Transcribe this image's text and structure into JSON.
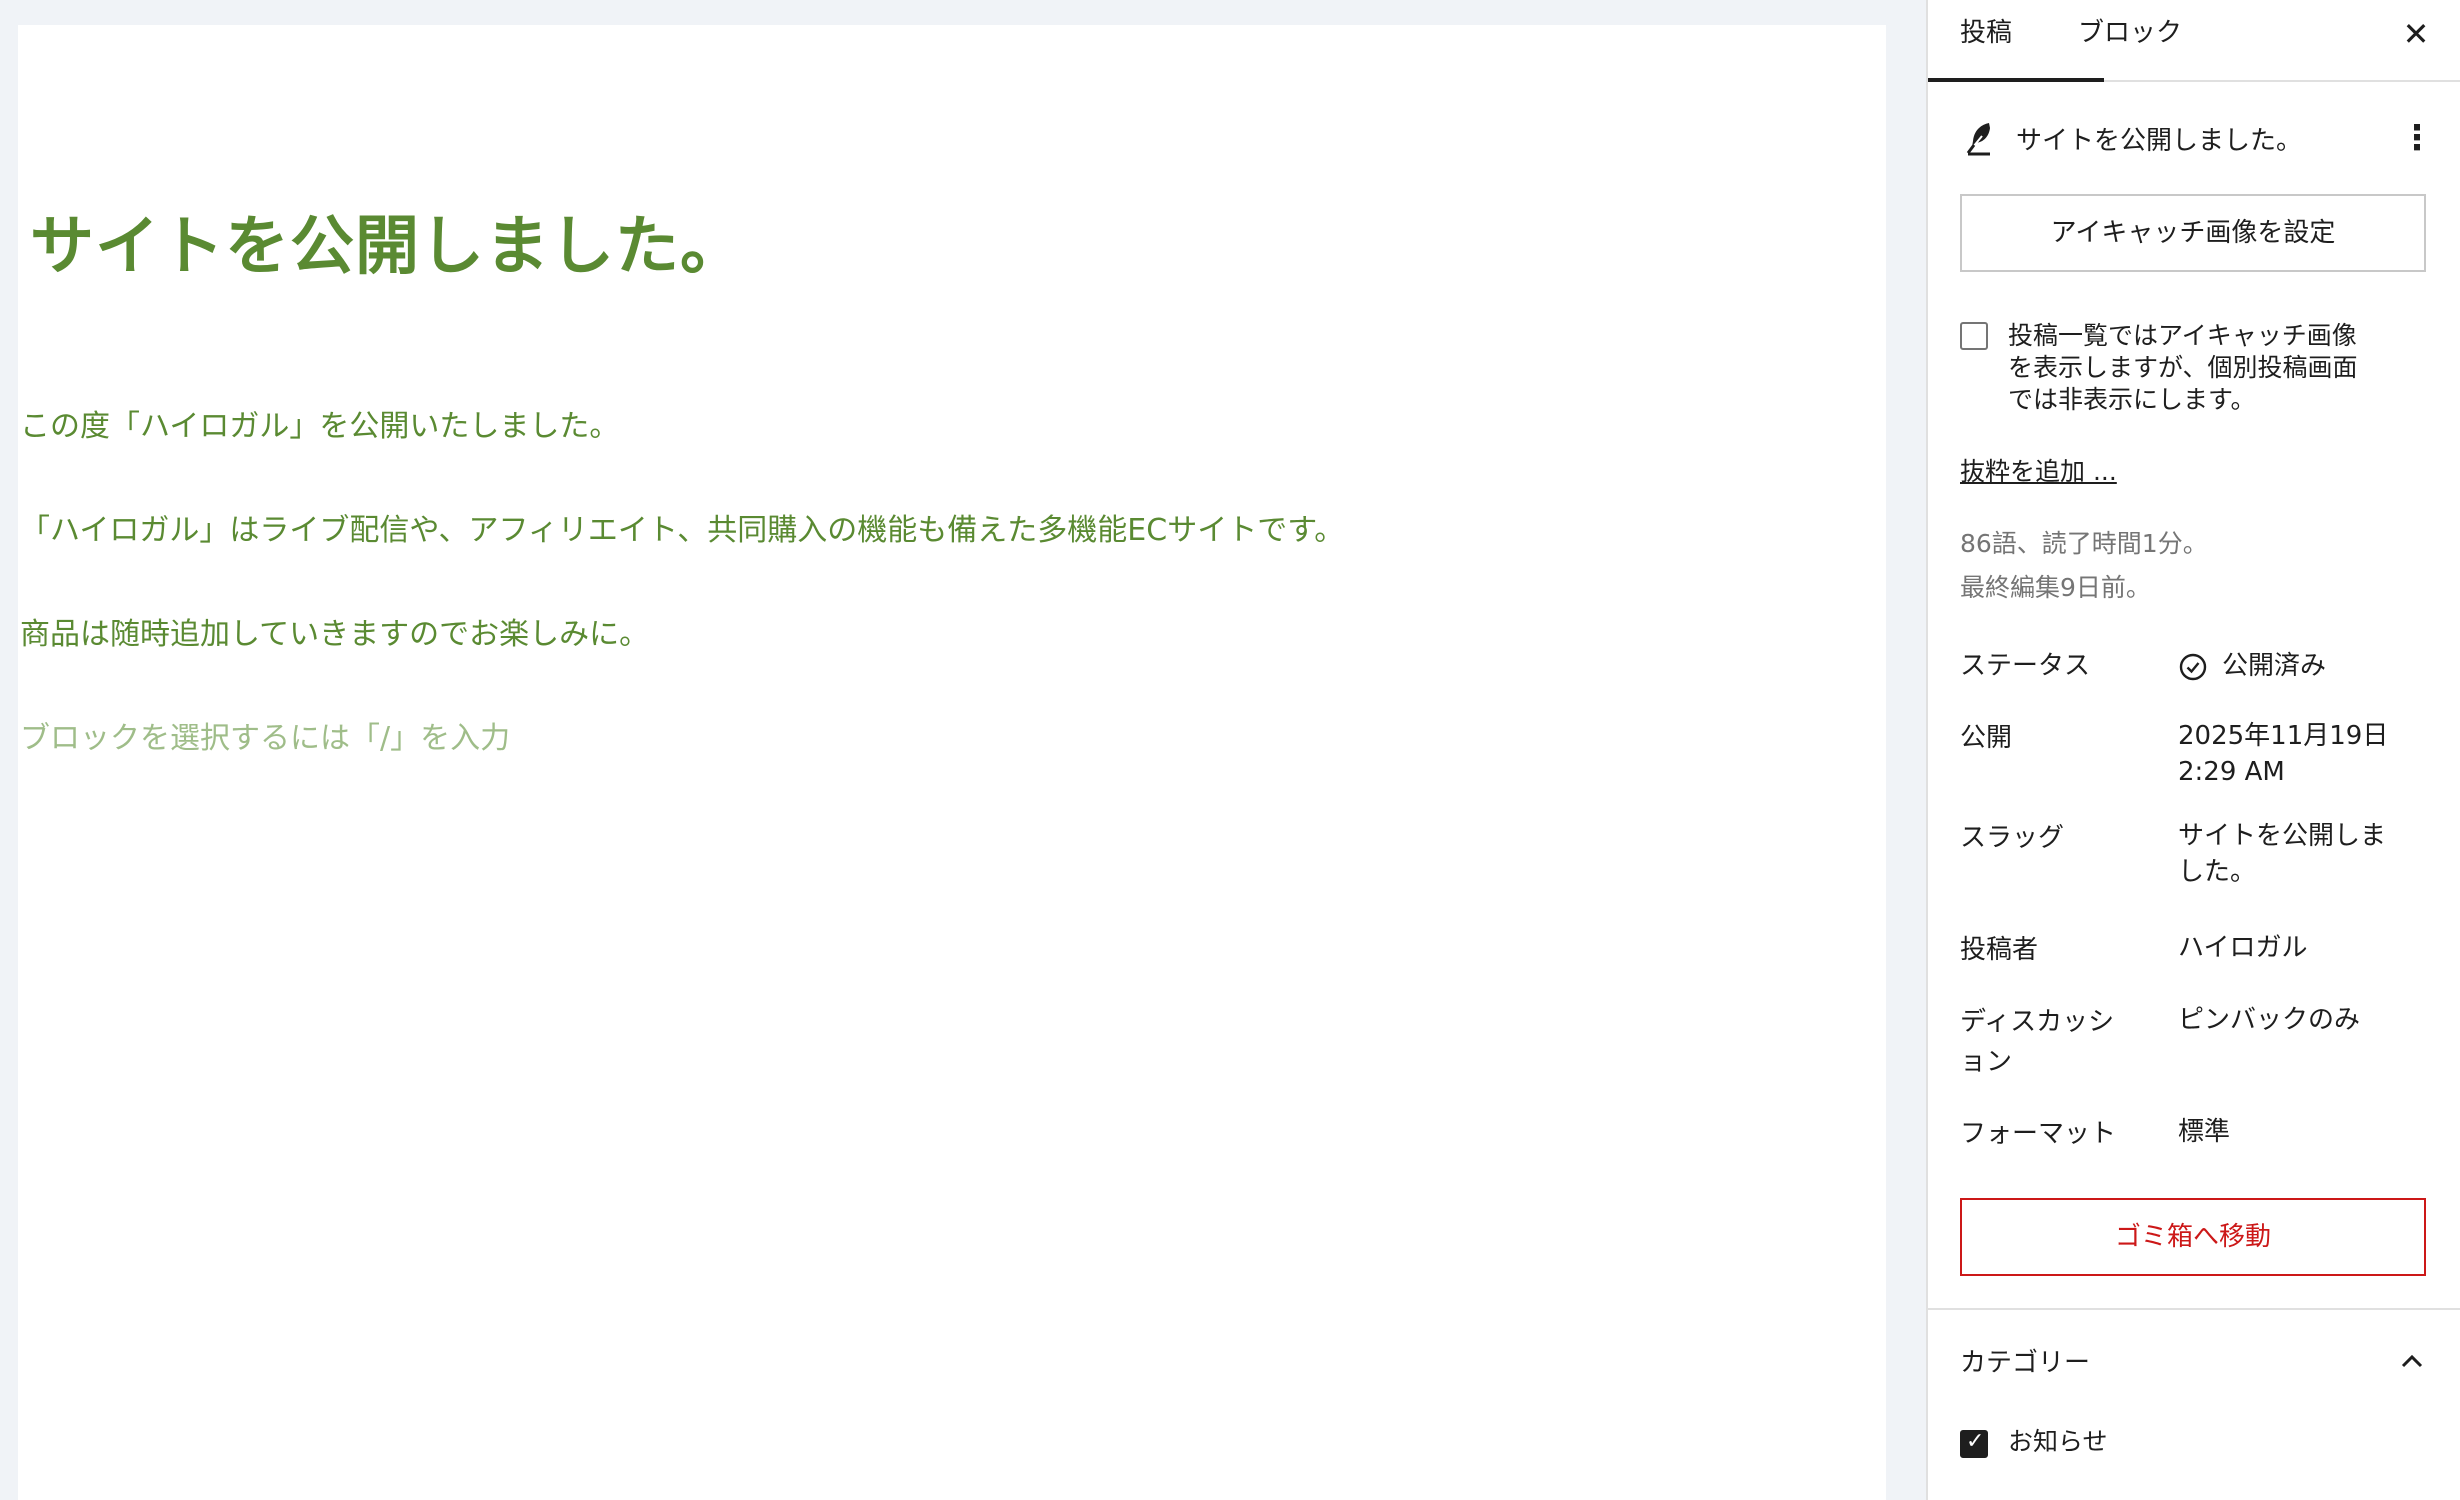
{
  "editor": {
    "title": "サイトを公開しました。",
    "paragraphs": [
      "この度「ハイロガル」を公開いたしました。",
      "「ハイロガル」はライブ配信や、アフィリエイト、共同購入の機能も備えた多機能ECサイトです。",
      "商品は随時追加していきますのでお楽しみに。"
    ],
    "placeholder": "ブロックを選択するには「/」を入力",
    "colors": {
      "text": "#5a8a32",
      "placeholder": "#9fbd89"
    }
  },
  "sidebar": {
    "tabs": [
      {
        "label": "投稿",
        "active": true
      },
      {
        "label": "ブロック",
        "active": false
      }
    ],
    "close_icon": "close-icon",
    "summary": {
      "icon": "feather-icon",
      "title": "サイトを公開しました。",
      "menu_icon": "more-vertical-icon"
    },
    "featured_image_button": "アイキャッチ画像を設定",
    "featured_checkbox": {
      "label": "投稿一覧ではアイキャッチ画像を表示しますが、個別投稿画面では非表示にします。",
      "checked": false
    },
    "excerpt_link": "抜粋を追加 ...",
    "word_count": "86語、読了時間1分。",
    "last_edited": "最終編集9日前。",
    "properties": {
      "status": {
        "label": "ステータス",
        "value": "公開済み",
        "icon": "check-circle-icon"
      },
      "publish": {
        "label": "公開",
        "value_line1": "2025年11月19日",
        "value_line2": "2:29 AM"
      },
      "slug": {
        "label": "スラッグ",
        "value": "サイトを公開しました。"
      },
      "author": {
        "label": "投稿者",
        "value": "ハイロガル"
      },
      "discussion": {
        "label": "ディスカッション",
        "value": "ピンバックのみ"
      },
      "format": {
        "label": "フォーマット",
        "value": "標準"
      }
    },
    "trash_button": "ゴミ箱へ移動",
    "category": {
      "title": "カテゴリー",
      "toggle_icon": "chevron-up-icon",
      "items": [
        {
          "label": "お知らせ",
          "checked": true
        }
      ]
    },
    "colors": {
      "danger": "#cc1818",
      "muted": "#757575",
      "border": "#e0e0e0"
    }
  }
}
